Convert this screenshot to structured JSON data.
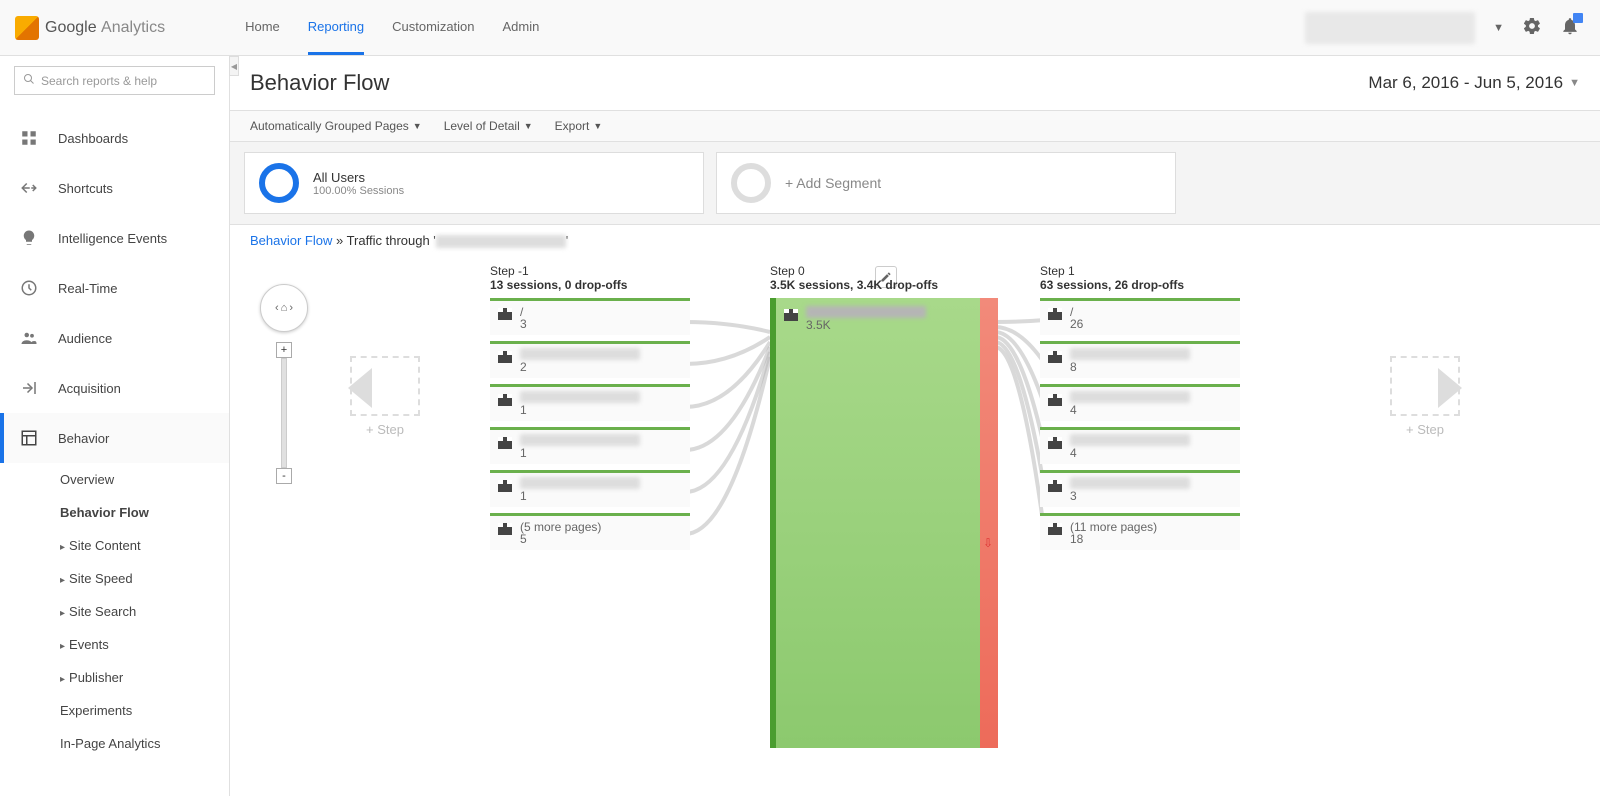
{
  "header": {
    "logo_google": "Google",
    "logo_analytics": "Analytics",
    "nav": [
      "Home",
      "Reporting",
      "Customization",
      "Admin"
    ],
    "active_nav": 1
  },
  "sidebar": {
    "search_placeholder": "Search reports & help",
    "items": [
      {
        "label": "Dashboards",
        "icon": "grid"
      },
      {
        "label": "Shortcuts",
        "icon": "arrows"
      },
      {
        "label": "Intelligence Events",
        "icon": "bulb"
      },
      {
        "label": "Real-Time",
        "icon": "clock"
      },
      {
        "label": "Audience",
        "icon": "people"
      },
      {
        "label": "Acquisition",
        "icon": "share"
      },
      {
        "label": "Behavior",
        "icon": "layout",
        "active": true
      }
    ],
    "sub_items": [
      {
        "label": "Overview"
      },
      {
        "label": "Behavior Flow",
        "bold": true
      },
      {
        "label": "Site Content",
        "caret": true
      },
      {
        "label": "Site Speed",
        "caret": true
      },
      {
        "label": "Site Search",
        "caret": true
      },
      {
        "label": "Events",
        "caret": true
      },
      {
        "label": "Publisher",
        "caret": true
      },
      {
        "label": "Experiments"
      },
      {
        "label": "In-Page Analytics"
      }
    ]
  },
  "page": {
    "title": "Behavior Flow",
    "date_range": "Mar 6, 2016 - Jun 5, 2016",
    "toolbar": {
      "pages": "Automatically Grouped Pages",
      "detail": "Level of Detail",
      "export": "Export"
    },
    "segment_all": "All Users",
    "segment_all_sub": "100.00% Sessions",
    "add_segment": "+ Add Segment",
    "breadcrumb_link": "Behavior Flow",
    "breadcrumb_sep": " » ",
    "breadcrumb_text": "Traffic through '",
    "breadcrumb_end": "'",
    "add_step_label": "+ Step"
  },
  "flow": {
    "columns": [
      {
        "step": "Step -1",
        "stats": "13 sessions, 0 drop-offs",
        "nodes": [
          {
            "label": "/",
            "count": "3"
          },
          {
            "label": "",
            "count": "2",
            "blur": true
          },
          {
            "label": "",
            "count": "1",
            "blur": true
          },
          {
            "label": "",
            "count": "1",
            "blur": true
          },
          {
            "label": "",
            "count": "1",
            "blur": true
          },
          {
            "label": "(5 more pages)",
            "count": "5"
          }
        ]
      },
      {
        "step": "Step 0",
        "stats": "3.5K sessions, 3.4K drop-offs",
        "big": true,
        "nodes": [
          {
            "label": "",
            "count": "3.5K",
            "blur": true
          }
        ]
      },
      {
        "step": "Step 1",
        "stats": "63 sessions, 26 drop-offs",
        "nodes": [
          {
            "label": "/",
            "count": "26"
          },
          {
            "label": "",
            "count": "8",
            "blur": true
          },
          {
            "label": "",
            "count": "4",
            "blur": true
          },
          {
            "label": "",
            "count": "4",
            "blur": true
          },
          {
            "label": "",
            "count": "3",
            "blur": true
          },
          {
            "label": "(11 more pages)",
            "count": "18"
          }
        ]
      }
    ]
  }
}
